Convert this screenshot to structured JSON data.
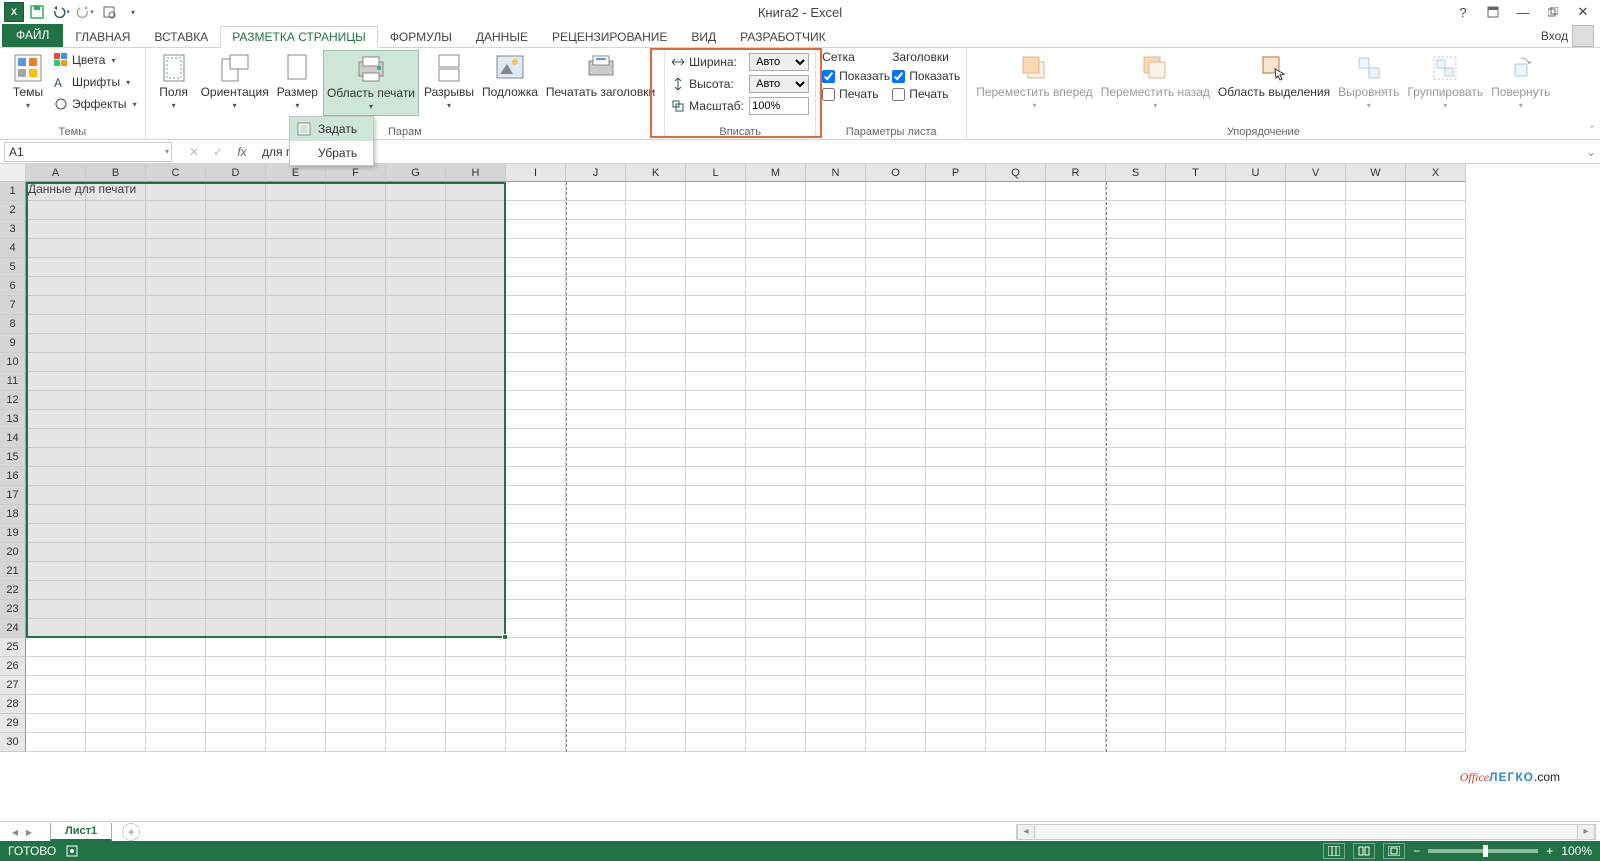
{
  "app": {
    "title": "Книга2 - Excel",
    "login": "Вход"
  },
  "qat": {
    "save": "save",
    "undo": "undo",
    "redo": "redo",
    "preview": "preview"
  },
  "tabs": {
    "file": "ФАЙЛ",
    "items": [
      "ГЛАВНАЯ",
      "ВСТАВКА",
      "РАЗМЕТКА СТРАНИЦЫ",
      "ФОРМУЛЫ",
      "ДАННЫЕ",
      "РЕЦЕНЗИРОВАНИЕ",
      "ВИД",
      "РАЗРАБОТЧИК"
    ],
    "active": 2
  },
  "ribbon": {
    "themes": {
      "label": "Темы",
      "themes": "Темы",
      "colors": "Цвета",
      "fonts": "Шрифты",
      "effects": "Эффекты"
    },
    "pagesetup": {
      "label": "Парам",
      "margins": "Поля",
      "orientation": "Ориентация",
      "size": "Размер",
      "printarea": "Область печати",
      "breaks": "Разрывы",
      "background": "Подложка",
      "printtitles": "Печатать заголовки"
    },
    "printarea_menu": {
      "set": "Задать",
      "clear": "Убрать"
    },
    "scale": {
      "label": "Вписать",
      "width": "Ширина:",
      "height": "Высота:",
      "scale": "Масштаб:",
      "width_val": "Авто",
      "height_val": "Авто",
      "scale_val": "100%"
    },
    "sheet": {
      "label": "Параметры листа",
      "grid": "Сетка",
      "headings": "Заголовки",
      "show": "Показать",
      "print": "Печать",
      "grid_show": true,
      "grid_print": false,
      "head_show": true,
      "head_print": false
    },
    "arrange": {
      "label": "Упорядочение",
      "forward": "Переместить вперед",
      "backward": "Переместить назад",
      "selection": "Область выделения",
      "align": "Выровнять",
      "group": "Группировать",
      "rotate": "Повернуть"
    }
  },
  "namebox": "A1",
  "formula": "для печати",
  "columns": [
    "A",
    "B",
    "C",
    "D",
    "E",
    "F",
    "G",
    "H",
    "I",
    "J",
    "K",
    "L",
    "M",
    "N",
    "O",
    "P",
    "Q",
    "R",
    "S",
    "T",
    "U",
    "V",
    "W",
    "X"
  ],
  "rows_count": 30,
  "cell_A1": "Данные для печати",
  "selection": {
    "cols": 8,
    "rows": 24
  },
  "sheet_tab": "Лист1",
  "status": "ГОТОВО",
  "zoom": "100%",
  "watermark": {
    "p1": "Office",
    "p2": "ЛЕГКО",
    "p3": ".com"
  }
}
